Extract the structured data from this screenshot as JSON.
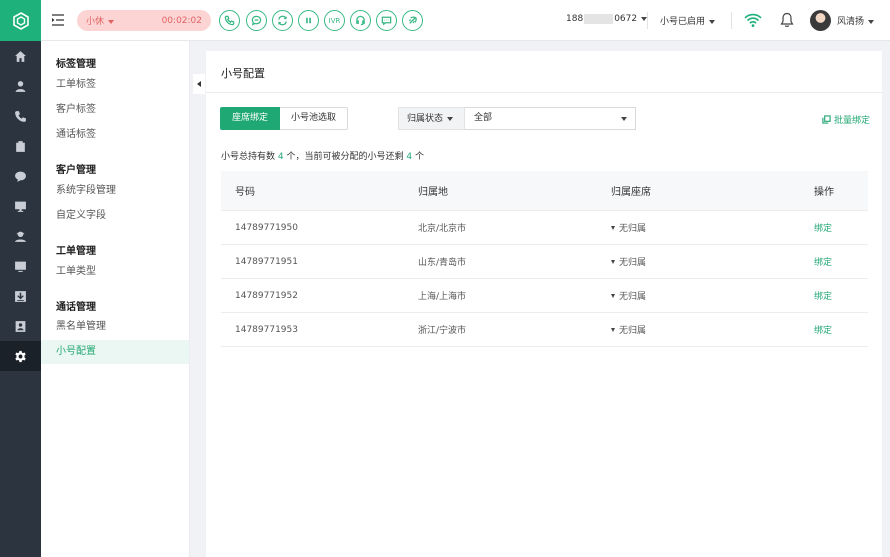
{
  "topbar": {
    "status_label": "小休",
    "timer": "00:02:02",
    "ivr_label": "IVR",
    "phone_prefix": "188",
    "phone_suffix": "0672",
    "sub_status": "小号已启用",
    "user_name": "风清扬"
  },
  "sidebar": {
    "groups": [
      {
        "title": "标签管理",
        "items": [
          "工单标签",
          "客户标签",
          "通话标签"
        ]
      },
      {
        "title": "客户管理",
        "items": [
          "系统字段管理",
          "自定义字段"
        ]
      },
      {
        "title": "工单管理",
        "items": [
          "工单类型"
        ]
      },
      {
        "title": "通话管理",
        "items": [
          "黑名单管理",
          "小号配置"
        ]
      }
    ]
  },
  "main": {
    "title": "小号配置",
    "tabs": [
      "座席绑定",
      "小号池选取"
    ],
    "filter_label": "归属状态",
    "filter_value": "全部",
    "batch_bind": "批量绑定",
    "summary": {
      "prefix": "小号总持有数",
      "total": "4",
      "middle": "个，当前可被分配的小号还剩",
      "remaining": "4",
      "suffix": "个"
    },
    "columns": [
      "号码",
      "归属地",
      "归属座席",
      "操作"
    ],
    "rows": [
      {
        "number": "14789771950",
        "location": "北京/北京市",
        "agent": "无归属",
        "action": "绑定"
      },
      {
        "number": "14789771951",
        "location": "山东/青岛市",
        "agent": "无归属",
        "action": "绑定"
      },
      {
        "number": "14789771952",
        "location": "上海/上海市",
        "agent": "无归属",
        "action": "绑定"
      },
      {
        "number": "14789771953",
        "location": "浙江/宁波市",
        "agent": "无归属",
        "action": "绑定"
      }
    ]
  },
  "colors": {
    "accent": "#1fa874",
    "rail": "#2c3440",
    "status_pill": "#fcd4d4"
  }
}
